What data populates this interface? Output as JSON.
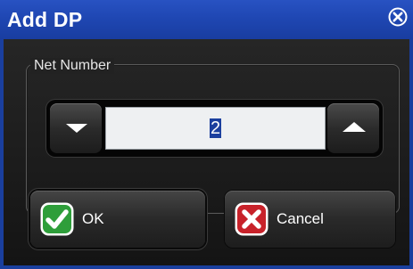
{
  "window": {
    "title": "Add DP"
  },
  "icons": {
    "close": "close-circle-icon",
    "decrement": "triangle-down-icon",
    "increment": "triangle-up-icon",
    "ok": "check-mark-icon",
    "cancel": "x-mark-icon"
  },
  "net_number": {
    "label": "Net Number",
    "value": "2"
  },
  "buttons": {
    "ok_label": "OK",
    "cancel_label": "Cancel"
  },
  "colors": {
    "title_bar": "#1f47b3",
    "ok_icon": "#2e9e3a",
    "cancel_icon": "#c8222a",
    "selection": "#1b3f9e"
  }
}
